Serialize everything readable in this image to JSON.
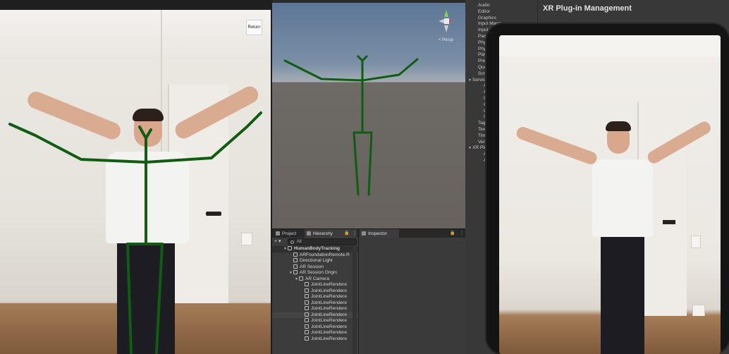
{
  "camera_view": {
    "return_label": "Return",
    "skeleton_color": "#0f5c12"
  },
  "scene_view": {
    "perspective_label": "< Persp",
    "skeleton_color": "#0f5c12"
  },
  "tabs": {
    "project": "Project",
    "hierarchy": "Hierarchy",
    "inspector": "Inspector"
  },
  "hierarchy": {
    "add_label": "+ ▾",
    "search_placeholder": "All",
    "scene_name": "HumanBodyTracking",
    "items": [
      "ARFoundationRemote.R",
      "Directional Light",
      "AR Session",
      "AR Session Origin",
      "AR Camera",
      "JointLineRendere",
      "JointLineRendere",
      "JointLineRendere",
      "JointLineRendere",
      "JointLineRendere",
      "JointLineRendere",
      "JointLineRendere",
      "JointLineRendere",
      "JointLineRendere",
      "JointLineRendere"
    ]
  },
  "project_settings": {
    "title": "XR Plug-in Management",
    "items": [
      "Audio",
      "Editor",
      "Graphics",
      "Input Mana",
      "Input Sy",
      "Packa",
      "Physic",
      "Physic",
      "Player",
      "Preset",
      "Quality",
      "Script",
      "Servic",
      "Ads",
      "Ana",
      "Clou",
      "Clou",
      "Coll",
      "In-A",
      "Tags a",
      "TextM",
      "Time",
      "Versio",
      "XR Plu",
      "ARC",
      "ARK"
    ]
  },
  "colors": {
    "unity_bg": "#383838",
    "tab_bar": "#282828",
    "tablet_frame": "#141414"
  }
}
